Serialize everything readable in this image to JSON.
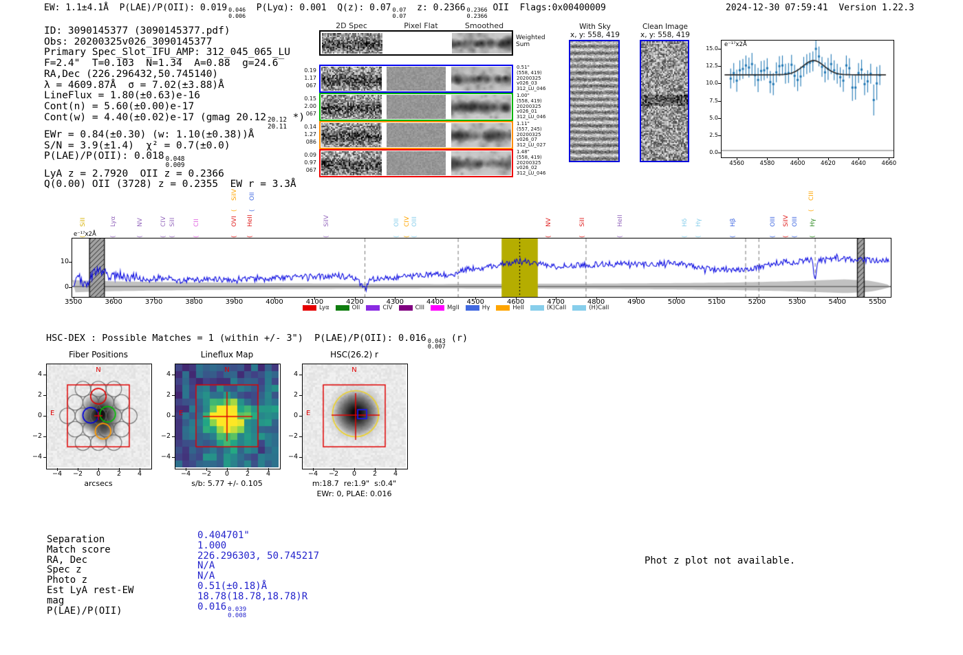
{
  "header": {
    "ew": "EW: 1.1±4.1Å  ",
    "plae": "P(LAE)/P(OII): 0.019",
    "plae_hi": "0.046",
    "plae_lo": "0.006",
    "plya": "  P(Lyα): 0.001  ",
    "qz": "Q(z): 0.07",
    "qz_hi": "0.07",
    "qz_lo": "0.07",
    "z": "  z: 0.2366",
    "z_hi": "0.2366",
    "z_lo": "0.2366",
    "ztail": " OII  Flags:0x00400009",
    "timestamp": "2024-12-30 07:59:41  Version 1.22.3"
  },
  "info": {
    "line1": "ID: 3090145377 (3090145377.pdf)",
    "line2": "Obs: 20200325v026_3090145377",
    "line3": "Primary Spec_Slot_IFU_AMP: 312_045_065_LU",
    "line4": "F=2.4\"  T=0.1̅03  N=1.3̅4  A=0.88  g=24.6̅",
    "line5": "RA,Dec (226.296432,50.745140)",
    "line6": "λ = 4609.87Å  σ = 7.02(±3.88)Å",
    "line7": "LineFlux = 1.80(±0.63)e-16",
    "line8": "Cont(n) = 5.60(±0.00)e-17",
    "line9a": "Cont(w) = 4.40(±0.02)e-17 (gmag 20.12",
    "line9_hi": "20.12",
    "line9_lo": "20.11",
    "line9b": " *)",
    "line10": "EWr = 0.84(±0.30) (w: 1.10(±0.38))Å",
    "line11": "S/N = 3.9(±1.4)  χ² = 0.7(±0.0)",
    "line12a": "P(LAE)/P(OII): 0.018",
    "line12_hi": "0.048",
    "line12_lo": "0.009",
    "line13": "LyA z = 2.7920  OII z = 0.2366",
    "line14": "Q(0.00) OII (3728) z = 0.2355  EW r = 3.3Å"
  },
  "spec2d": {
    "col_headers": [
      "2D Spec",
      "Pixel Flat",
      "Smoothed"
    ],
    "ws_label1": "Weighted",
    "ws_label2": "Sum",
    "rows": [
      {
        "color": "#0000ee",
        "left": [
          "0.19",
          "1.17",
          "067"
        ],
        "right": [
          "0.51\"",
          "(558, 419)",
          "20200325",
          "v026_03",
          "312_LU_046"
        ]
      },
      {
        "color": "#00b400",
        "left": [
          "0.15",
          "2.00",
          "067"
        ],
        "right": [
          "1.00\"",
          "(558, 419)",
          "20200325",
          "v026_01",
          "312_LU_046"
        ]
      },
      {
        "color": "#ff8c00",
        "left": [
          "0.14",
          "1.27",
          "086"
        ],
        "right": [
          "1.11\"",
          "(557, 245)",
          "20200325",
          "v026_07",
          "312_LU_027"
        ]
      },
      {
        "color": "#ee0000",
        "left": [
          "0.09",
          "0.97",
          "067"
        ],
        "right": [
          "1.48\"",
          "(558, 419)",
          "20200325",
          "v026_02",
          "312_LU_046"
        ]
      }
    ]
  },
  "cutouts2d": {
    "with_sky_title": "With Sky",
    "with_sky_coords": "x, y: 558, 419",
    "clean_title": "Clean Image",
    "clean_coords": "x, y: 558, 419"
  },
  "fitplot": {
    "unit_label": "e⁻¹⁷x2Å"
  },
  "spectrum": {
    "unit_label": "e⁻¹⁷x2Å",
    "line_labels": [
      {
        "wl": 3542,
        "name": "SiII",
        "color": "#d9b40c",
        "row": 0
      },
      {
        "wl": 3617,
        "name": "Lyα",
        "color": "#9467bd",
        "row": 0
      },
      {
        "wl": 3684,
        "name": "NV",
        "color": "#9467bd",
        "row": 0
      },
      {
        "wl": 3742,
        "name": "CIV",
        "color": "#9467bd",
        "row": 0
      },
      {
        "wl": 3764,
        "name": "SiII",
        "color": "#9467bd",
        "row": 0
      },
      {
        "wl": 3823,
        "name": "CII",
        "color": "#e060e0",
        "row": 0
      },
      {
        "wl": 3918,
        "name": "OVI",
        "color": "#e02020",
        "row": 0
      },
      {
        "wl": 3918,
        "name": "SiIV",
        "color": "#ffa500",
        "row": 1
      },
      {
        "wl": 3958,
        "name": "HeII",
        "color": "#e02020",
        "row": 0
      },
      {
        "wl": 3962,
        "name": "OII",
        "color": "#4169e1",
        "row": 1
      },
      {
        "wl": 4148,
        "name": "SiIV",
        "color": "#9467bd",
        "row": 0
      },
      {
        "wl": 4321,
        "name": "OII",
        "color": "#87ceeb",
        "row": 0
      },
      {
        "wl": 4347,
        "name": "CIV",
        "color": "#ffa500",
        "row": 0
      },
      {
        "wl": 4366,
        "name": "OIII",
        "color": "#87ceeb",
        "row": 0
      },
      {
        "wl": 4699,
        "name": "NV",
        "color": "#e02020",
        "row": 0
      },
      {
        "wl": 4784,
        "name": "SiII",
        "color": "#e02020",
        "row": 0
      },
      {
        "wl": 4877,
        "name": "HeII",
        "color": "#9467bd",
        "row": 0
      },
      {
        "wl": 5039,
        "name": "Hδ",
        "color": "#87ceeb",
        "row": 0
      },
      {
        "wl": 5073,
        "name": "Hγ",
        "color": "#87ceeb",
        "row": 0
      },
      {
        "wl": 5158,
        "name": "Hβ",
        "color": "#4169e1",
        "row": 0
      },
      {
        "wl": 5257,
        "name": "OIII",
        "color": "#4169e1",
        "row": 0
      },
      {
        "wl": 5290,
        "name": "SiIV",
        "color": "#e02020",
        "row": 0
      },
      {
        "wl": 5312,
        "name": "OIII",
        "color": "#4169e1",
        "row": 0
      },
      {
        "wl": 5357,
        "name": "Hγ",
        "color": "#2e8b22",
        "row": 0
      },
      {
        "wl": 5353,
        "name": "CIII",
        "color": "#ffa500",
        "row": 1
      }
    ],
    "legend": [
      {
        "label": "Lyα",
        "color": "#e50000"
      },
      {
        "label": "OII",
        "color": "#0f7d0f"
      },
      {
        "label": "CIV",
        "color": "#8a2be2"
      },
      {
        "label": "CIII",
        "color": "#800080"
      },
      {
        "label": "MgII",
        "color": "#ff00ff"
      },
      {
        "label": "Hγ",
        "color": "#4169e1"
      },
      {
        "label": "HeII",
        "color": "#ffa500"
      },
      {
        "label": "(K)CaII",
        "color": "#87ceeb"
      },
      {
        "label": "(H)CaII",
        "color": "#87ceeb"
      }
    ]
  },
  "hscdex": {
    "text": "HSC-DEX : Possible Matches = 1 (within +/- 3\")  P(LAE)/P(OII): 0.016",
    "hi": "0.043",
    "lo": "0.007",
    "tail": " (r)"
  },
  "panels": [
    {
      "title": "Fiber Positions",
      "north": "N",
      "east": "E",
      "yticks": [
        "4",
        "2",
        "0",
        "−2",
        "−4"
      ],
      "xticks": [
        "−4",
        "−2",
        "0",
        "2",
        "4"
      ],
      "xlabel": "arcsecs",
      "xlabel2": ""
    },
    {
      "title": "Lineflux Map",
      "north": "N",
      "east": "E",
      "yticks": [
        "4",
        "2",
        "0",
        "−2",
        "−4"
      ],
      "xticks": [
        "−4",
        "−2",
        "0",
        "2",
        "4"
      ],
      "xlabel": "s/b: 5.77 +/- 0.105",
      "xlabel2": ""
    },
    {
      "title": "HSC(26.2) r",
      "north": "N",
      "east": "E",
      "yticks": [
        "4",
        "2",
        "0",
        "−2",
        "−4"
      ],
      "xticks": [
        "−4",
        "−2",
        "0",
        "2",
        "4"
      ],
      "xlabel": "m:18.7  re:1.9\"  s:0.4\"",
      "xlabel2": "EWr: 0, PLAE: 0.016"
    }
  ],
  "match_table": {
    "rows": [
      {
        "label": "Separation",
        "value": "0.404701\""
      },
      {
        "label": "Match score",
        "value": "1.000"
      },
      {
        "label": "RA, Dec",
        "value": "226.296303, 50.745217"
      },
      {
        "label": "Spec z",
        "value": "N/A"
      },
      {
        "label": "Photo z",
        "value": "N/A"
      },
      {
        "label": "Est LyA rest-EW",
        "value": "0.51(±0.18)Å"
      },
      {
        "label": "mag",
        "value": "18.78(18.78,18.78)R"
      },
      {
        "label": "P(LAE)/P(OII)",
        "value": "0.016",
        "hi": "0.039",
        "lo": "0.008"
      }
    ]
  },
  "notice": "Phot z plot not available.",
  "chart_data": [
    {
      "id": "line_fit_zoom",
      "type": "scatter",
      "title": "emission line fit around 4610Å",
      "ylabel": "e⁻¹⁷x2Å",
      "xlim": [
        4550,
        4663
      ],
      "ylim": [
        -0.7,
        16.2
      ],
      "xticks": [
        4560,
        4580,
        4600,
        4620,
        4640,
        4660
      ],
      "yticks": [
        15.0,
        12.5,
        10.0,
        7.5,
        5.0,
        2.5,
        0.0
      ],
      "gaussian_fit": {
        "center": 4610.5,
        "sigma": 7.0,
        "amplitude": 2.05,
        "continuum": 11.25
      },
      "points": [
        [
          4556,
          10.7,
          0.9
        ],
        [
          4558,
          11.5,
          0.9
        ],
        [
          4560,
          10.4,
          1.0
        ],
        [
          4562,
          11.9,
          0.9
        ],
        [
          4564,
          12.1,
          0.9
        ],
        [
          4566,
          12.6,
          0.9
        ],
        [
          4568,
          12.3,
          0.9
        ],
        [
          4570,
          12.8,
          1.0
        ],
        [
          4572,
          11.2,
          1.0
        ],
        [
          4574,
          10.5,
          1.1
        ],
        [
          4576,
          11.8,
          0.9
        ],
        [
          4578,
          11.9,
          0.9
        ],
        [
          4580,
          12.2,
          0.9
        ],
        [
          4582,
          10.2,
          1.0
        ],
        [
          4584,
          9.9,
          1.0
        ],
        [
          4586,
          11.6,
          0.9
        ],
        [
          4588,
          12.5,
          0.9
        ],
        [
          4590,
          12.6,
          0.9
        ],
        [
          4592,
          11.4,
          0.9
        ],
        [
          4594,
          11.5,
          0.9
        ],
        [
          4596,
          12.7,
          0.9
        ],
        [
          4598,
          11.1,
          1.0
        ],
        [
          4600,
          10.5,
          1.0
        ],
        [
          4602,
          11.0,
          0.9
        ],
        [
          4604,
          12.4,
          0.9
        ],
        [
          4606,
          12.8,
          0.9
        ],
        [
          4608,
          13.0,
          0.9
        ],
        [
          4610,
          13.2,
          0.9
        ],
        [
          4612,
          15.0,
          1.1
        ],
        [
          4614,
          13.9,
          0.9
        ],
        [
          4616,
          12.4,
          0.9
        ],
        [
          4618,
          11.6,
          0.9
        ],
        [
          4620,
          12.1,
          1.0
        ],
        [
          4622,
          12.8,
          0.9
        ],
        [
          4624,
          11.9,
          0.9
        ],
        [
          4626,
          11.4,
          0.9
        ],
        [
          4628,
          10.9,
          0.9
        ],
        [
          4630,
          10.4,
          1.0
        ],
        [
          4632,
          12.6,
          0.9
        ],
        [
          4634,
          12.2,
          0.9
        ],
        [
          4636,
          9.4,
          1.2
        ],
        [
          4638,
          9.4,
          1.1
        ],
        [
          4640,
          11.5,
          0.9
        ],
        [
          4642,
          12.0,
          0.9
        ],
        [
          4644,
          9.9,
          1.0
        ],
        [
          4646,
          10.3,
          1.0
        ],
        [
          4648,
          11.4,
          0.9
        ],
        [
          4650,
          7.6,
          1.4
        ],
        [
          4652,
          10.0,
          1.5
        ],
        [
          4654,
          11.2,
          0.9
        ]
      ]
    },
    {
      "id": "full_spectrum",
      "type": "line",
      "title": "full HETDEX spectrum",
      "ylabel": "e⁻¹⁷x2Å",
      "xlim": [
        3497,
        5533
      ],
      "ylim": [
        -3.9,
        19.1
      ],
      "xticks": [
        3500,
        3600,
        3700,
        3800,
        3900,
        4000,
        4100,
        4200,
        4300,
        4400,
        4500,
        4600,
        4700,
        4800,
        4900,
        5000,
        5100,
        5200,
        5300,
        5400,
        5500
      ],
      "yticks": [
        10,
        0
      ],
      "highlight_band": [
        4565,
        4655
      ],
      "line_center": 4610,
      "dashed_lines": [
        4225,
        4457,
        4775,
        5172,
        5205,
        5345
      ],
      "hatch_bands": [
        [
          3540,
          3577
        ],
        [
          5450,
          5467
        ]
      ],
      "envelope": [
        [
          3500,
          2.0
        ],
        [
          3515,
          3.5
        ],
        [
          3530,
          1.0
        ],
        [
          3545,
          4.0
        ],
        [
          3560,
          6.5
        ],
        [
          3575,
          6.0
        ],
        [
          3590,
          3.5
        ],
        [
          3605,
          4.5
        ],
        [
          3620,
          5.0
        ],
        [
          3640,
          3.5
        ],
        [
          3660,
          4.2
        ],
        [
          3680,
          3.2
        ],
        [
          3700,
          3.0
        ],
        [
          3720,
          3.8
        ],
        [
          3740,
          3.2
        ],
        [
          3760,
          2.6
        ],
        [
          3780,
          2.8
        ],
        [
          3800,
          3.2
        ],
        [
          3820,
          2.8
        ],
        [
          3840,
          3.4
        ],
        [
          3860,
          3.0
        ],
        [
          3880,
          2.6
        ],
        [
          3900,
          2.4
        ],
        [
          3920,
          3.0
        ],
        [
          3940,
          3.2
        ],
        [
          3960,
          2.8
        ],
        [
          3980,
          3.0
        ],
        [
          4000,
          3.4
        ],
        [
          4040,
          3.8
        ],
        [
          4080,
          4.0
        ],
        [
          4120,
          4.2
        ],
        [
          4160,
          4.4
        ],
        [
          4200,
          3.6
        ],
        [
          4222,
          0.2
        ],
        [
          4228,
          -1.0
        ],
        [
          4235,
          3.0
        ],
        [
          4260,
          3.4
        ],
        [
          4300,
          3.8
        ],
        [
          4340,
          4.2
        ],
        [
          4380,
          4.8
        ],
        [
          4420,
          4.8
        ],
        [
          4450,
          5.2
        ],
        [
          4465,
          6.8
        ],
        [
          4490,
          7.2
        ],
        [
          4520,
          7.6
        ],
        [
          4550,
          8.6
        ],
        [
          4580,
          9.0
        ],
        [
          4605,
          10.2
        ],
        [
          4615,
          10.4
        ],
        [
          4635,
          9.6
        ],
        [
          4655,
          9.4
        ],
        [
          4675,
          8.8
        ],
        [
          4700,
          8.4
        ],
        [
          4730,
          8.6
        ],
        [
          4760,
          8.4
        ],
        [
          4790,
          8.8
        ],
        [
          4820,
          9.0
        ],
        [
          4850,
          9.0
        ],
        [
          4880,
          9.2
        ],
        [
          4910,
          8.8
        ],
        [
          4940,
          9.0
        ],
        [
          4970,
          9.4
        ],
        [
          5000,
          9.4
        ],
        [
          5030,
          8.6
        ],
        [
          5060,
          7.4
        ],
        [
          5090,
          6.8
        ],
        [
          5120,
          7.0
        ],
        [
          5150,
          6.8
        ],
        [
          5180,
          7.2
        ],
        [
          5210,
          7.8
        ],
        [
          5240,
          9.4
        ],
        [
          5270,
          9.8
        ],
        [
          5300,
          9.8
        ],
        [
          5320,
          10.6
        ],
        [
          5338,
          10.8
        ],
        [
          5345,
          1.2
        ],
        [
          5352,
          10.6
        ],
        [
          5370,
          11.0
        ],
        [
          5400,
          11.2
        ],
        [
          5430,
          10.8
        ],
        [
          5460,
          10.6
        ],
        [
          5490,
          10.6
        ],
        [
          5530,
          10.8
        ]
      ],
      "error_band_halfwidth": [
        [
          3497,
          2.4
        ],
        [
          3600,
          1.9
        ],
        [
          3800,
          1.5
        ],
        [
          4000,
          1.2
        ],
        [
          4200,
          1.0
        ],
        [
          4400,
          0.9
        ],
        [
          4600,
          0.95
        ],
        [
          4800,
          1.05
        ],
        [
          5000,
          1.25
        ],
        [
          5150,
          1.5
        ],
        [
          5300,
          2.0
        ],
        [
          5420,
          2.7
        ],
        [
          5480,
          2.2
        ],
        [
          5515,
          1.1
        ],
        [
          5533,
          0.3
        ]
      ],
      "noise_amp_typical": 1.2
    }
  ]
}
